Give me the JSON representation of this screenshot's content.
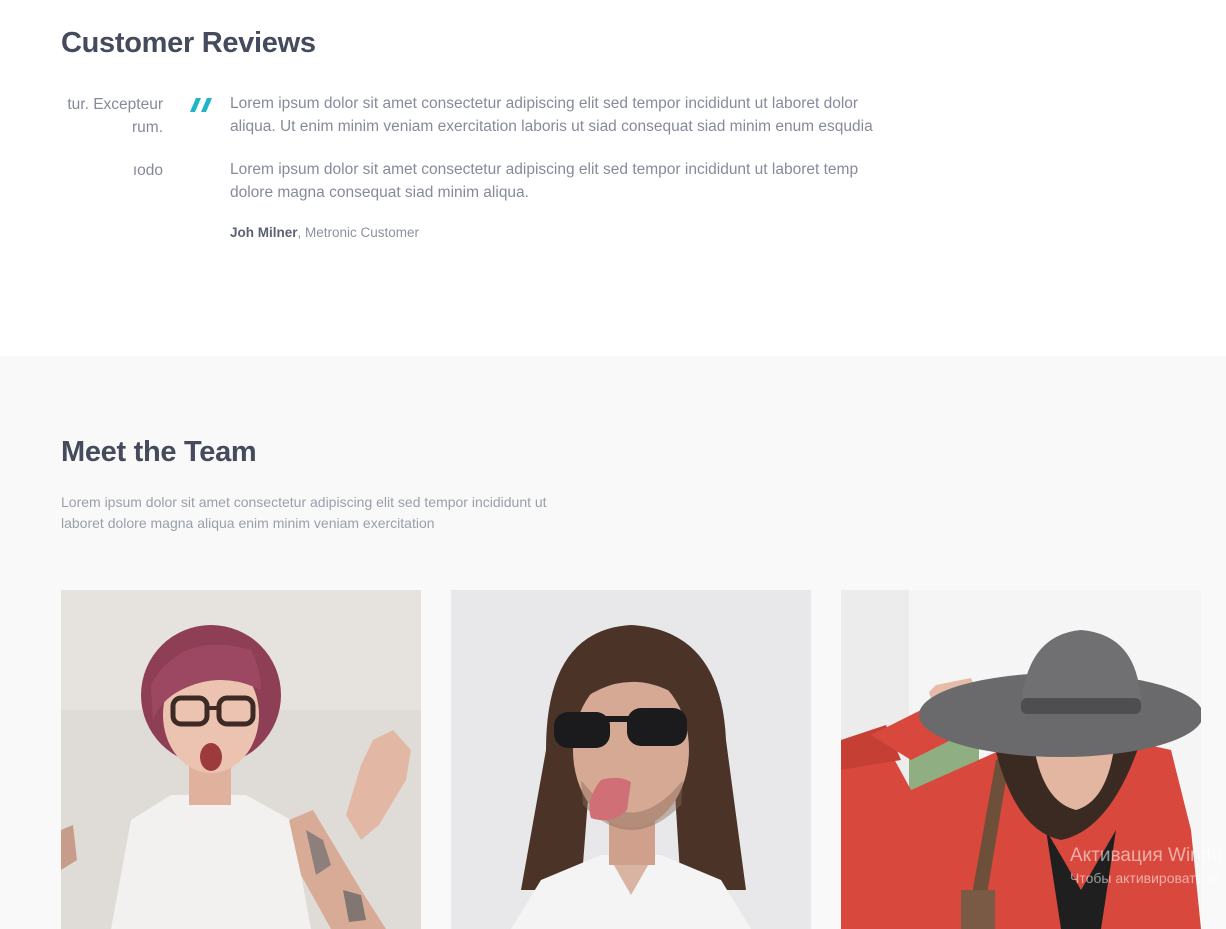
{
  "reviews": {
    "title": "Customer Reviews",
    "prev_slide": {
      "line1": "tur. Excepteur",
      "line2": "rum.",
      "line3": "ıodo"
    },
    "current": {
      "p1_line1": "Lorem ipsum dolor sit amet consectetur adipiscing elit sed tempor incididunt ut laboret dolor",
      "p1_line2": "aliqua. Ut enim minim veniam exercitation laboris ut siad consequat siad minim enum esqudia",
      "p2_line1": "Lorem ipsum dolor sit amet consectetur adipiscing elit sed tempor incididunt ut laboret temp",
      "p2_line2": "dolore magna consequat siad minim aliqua.",
      "author_name": "Joh Milner",
      "author_role": ", Metronic Customer"
    },
    "quote_icon": "double-quote-icon",
    "accent_color": "#1fb5c9"
  },
  "team": {
    "title": "Meet the Team",
    "desc_line1": "Lorem ipsum dolor sit amet consectetur adipiscing elit sed tempor incididunt ut",
    "desc_line2": "laboret dolore magna aliqua enim minim veniam exercitation",
    "members": [
      {
        "photo": "woman-with-glasses-photo"
      },
      {
        "photo": "man-with-sunglasses-photo"
      },
      {
        "photo": "woman-with-hat-photo"
      }
    ]
  },
  "watermark": {
    "line1": "Активация Windo",
    "line2": "Чтобы активировать W"
  }
}
